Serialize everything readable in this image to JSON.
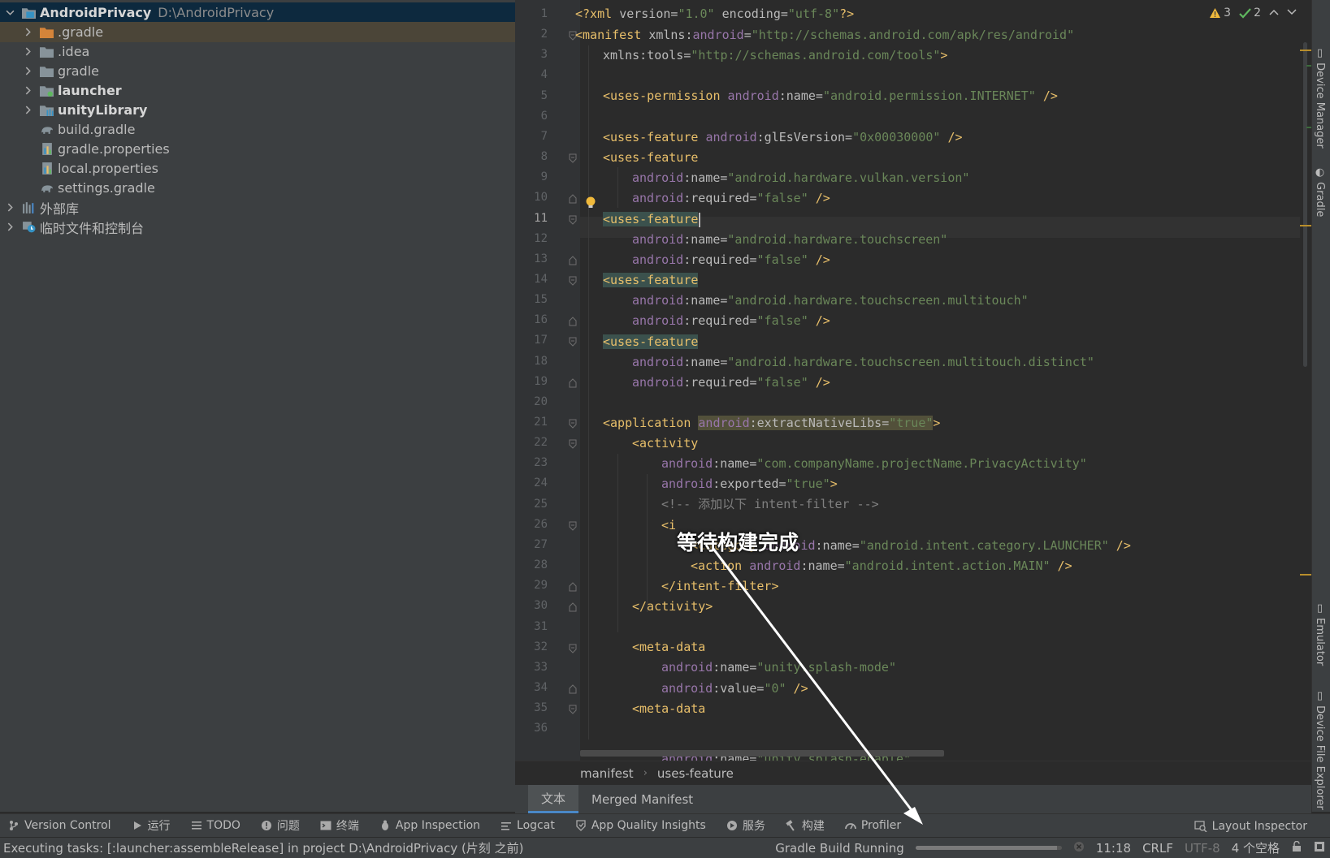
{
  "project_tree": {
    "root": {
      "name": "AndroidPrivacy",
      "path": "D:\\AndroidPrivacy"
    },
    "items": [
      {
        "label": ".gradle",
        "icon": "folder-orange-icon",
        "expandable": true,
        "bold": false
      },
      {
        "label": ".idea",
        "icon": "folder-icon",
        "expandable": true,
        "bold": false
      },
      {
        "label": "gradle",
        "icon": "folder-icon",
        "expandable": true,
        "bold": false
      },
      {
        "label": "launcher",
        "icon": "module-folder-icon",
        "expandable": true,
        "bold": true
      },
      {
        "label": "unityLibrary",
        "icon": "library-folder-icon",
        "expandable": true,
        "bold": true
      },
      {
        "label": "build.gradle",
        "icon": "gradle-elephant-icon",
        "expandable": false,
        "bold": false
      },
      {
        "label": "gradle.properties",
        "icon": "properties-file-icon",
        "expandable": false,
        "bold": false
      },
      {
        "label": "local.properties",
        "icon": "properties-file-icon",
        "expandable": false,
        "bold": false
      },
      {
        "label": "settings.gradle",
        "icon": "gradle-elephant-icon",
        "expandable": false,
        "bold": false
      }
    ],
    "external_libraries": "外部库",
    "scratches": "临时文件和控制台"
  },
  "editor": {
    "current_line": 11,
    "lines": [
      {
        "n": "1"
      },
      {
        "n": "2"
      },
      {
        "n": "3"
      },
      {
        "n": "4"
      },
      {
        "n": "5"
      },
      {
        "n": "6"
      },
      {
        "n": "7"
      },
      {
        "n": "8"
      },
      {
        "n": "9"
      },
      {
        "n": "10"
      },
      {
        "n": "11"
      },
      {
        "n": "12"
      },
      {
        "n": "13"
      },
      {
        "n": "14"
      },
      {
        "n": "15"
      },
      {
        "n": "16"
      },
      {
        "n": "17"
      },
      {
        "n": "18"
      },
      {
        "n": "19"
      },
      {
        "n": "20"
      },
      {
        "n": "21"
      },
      {
        "n": "22"
      },
      {
        "n": "23"
      },
      {
        "n": "24"
      },
      {
        "n": "25"
      },
      {
        "n": "26"
      },
      {
        "n": "27"
      },
      {
        "n": "28"
      },
      {
        "n": "29"
      },
      {
        "n": "30"
      },
      {
        "n": "31"
      },
      {
        "n": "32"
      },
      {
        "n": "33"
      },
      {
        "n": "34"
      },
      {
        "n": "35"
      },
      {
        "n": "36"
      }
    ],
    "code": {
      "l1": {
        "pi_open": "<?xml ",
        "a1": "version",
        "v1": "\"1.0\"",
        "a2": " encoding",
        "v2": "\"utf-8\"",
        "pi_close": "?>"
      },
      "l2": {
        "open": "<manifest ",
        "ns": "xmlns",
        "colon": ":",
        "attr": "android",
        "eq": "=",
        "val": "\"http://schemas.android.com/apk/res/android\""
      },
      "l3": {
        "ns": "xmlns",
        "colon": ":",
        "attr": "tools",
        "eq": "=",
        "val": "\"http://schemas.android.com/tools\"",
        "close": ">"
      },
      "l5": {
        "tag": "<uses-permission ",
        "ns": "android",
        "attr": ":name",
        "eq": "=",
        "val": "\"android.permission.INTERNET\"",
        "close": " />"
      },
      "l7": {
        "tag": "<uses-feature ",
        "ns": "android",
        "attr": ":glEsVersion",
        "eq": "=",
        "val": "\"0x00030000\"",
        "close": " />"
      },
      "l8": {
        "tag": "<uses-feature"
      },
      "l9": {
        "ns": "android",
        "attr": ":name",
        "eq": "=",
        "val": "\"android.hardware.vulkan.version\""
      },
      "l10": {
        "ns": "android",
        "attr": ":required",
        "eq": "=",
        "val": "\"false\"",
        "close": " />"
      },
      "l11": {
        "tag_lt": "<",
        "tag": "uses-feature"
      },
      "l12": {
        "ns": "android",
        "attr": ":name",
        "eq": "=",
        "val": "\"android.hardware.touchscreen\""
      },
      "l13": {
        "ns": "android",
        "attr": ":required",
        "eq": "=",
        "val": "\"false\"",
        "close": " />"
      },
      "l14": {
        "tag": "<uses-feature"
      },
      "l15": {
        "ns": "android",
        "attr": ":name",
        "eq": "=",
        "val": "\"android.hardware.touchscreen.multitouch\""
      },
      "l16": {
        "ns": "android",
        "attr": ":required",
        "eq": "=",
        "val": "\"false\"",
        "close": " />"
      },
      "l17": {
        "tag": "<uses-feature"
      },
      "l18": {
        "ns": "android",
        "attr": ":name",
        "eq": "=",
        "val": "\"android.hardware.touchscreen.multitouch.distinct\""
      },
      "l19": {
        "ns": "android",
        "attr": ":required",
        "eq": "=",
        "val": "\"false\"",
        "close": " />"
      },
      "l21": {
        "tag": "<application ",
        "ns": "android",
        "attr": ":extractNativeLibs",
        "eq": "=",
        "val": "\"true\"",
        "close": ">"
      },
      "l22": {
        "tag": "<activity"
      },
      "l23": {
        "ns": "android",
        "attr": ":name",
        "eq": "=",
        "val": "\"com.companyName.projectName.PrivacyActivity\""
      },
      "l24": {
        "ns": "android",
        "attr": ":exported",
        "eq": "=",
        "val": "\"true\"",
        "close": ">"
      },
      "l25": {
        "comment": "<!-- 添加以下 intent-filter -->"
      },
      "l26": {
        "tag": "<i"
      },
      "l27": {
        "tag": "<category ",
        "ns": "android",
        "attr": ":name",
        "eq": "=",
        "val": "\"android.intent.category.LAUNCHER\"",
        "close": " />"
      },
      "l28": {
        "tag": "<action ",
        "ns": "android",
        "attr": ":name",
        "eq": "=",
        "val": "\"android.intent.action.MAIN\"",
        "close": " />"
      },
      "l29": {
        "tag": "</intent-filter>"
      },
      "l30": {
        "tag": "</activity>"
      },
      "l32": {
        "tag": "<meta-data"
      },
      "l33": {
        "ns": "android",
        "attr": ":name",
        "eq": "=",
        "val": "\"unity.splash-mode\""
      },
      "l34": {
        "ns": "android",
        "attr": ":value",
        "eq": "=",
        "val": "\"0\"",
        "close": " />"
      },
      "l35": {
        "tag": "<meta-data"
      },
      "l36": {
        "ns": "android",
        "attr": ":name",
        "eq": "=",
        "val": "\"unity.splash-enable\""
      }
    },
    "inspections": {
      "warnings": "3",
      "typos": "2"
    }
  },
  "breadcrumb": [
    "manifest",
    "uses-feature"
  ],
  "editor_tabs": [
    {
      "label": "文本",
      "active": true
    },
    {
      "label": "Merged Manifest",
      "active": false
    }
  ],
  "right_tool_tabs": [
    "Device Manager",
    "Gradle",
    "Emulator",
    "Device File Explorer"
  ],
  "tool_windows": [
    {
      "label": "Version Control",
      "icon": "vcs-branch-icon"
    },
    {
      "label": "运行",
      "icon": "run-icon"
    },
    {
      "label": "TODO",
      "icon": "todo-list-icon"
    },
    {
      "label": "问题",
      "icon": "problems-icon"
    },
    {
      "label": "终端",
      "icon": "terminal-icon"
    },
    {
      "label": "App Inspection",
      "icon": "app-inspection-icon"
    },
    {
      "label": "Logcat",
      "icon": "logcat-icon"
    },
    {
      "label": "App Quality Insights",
      "icon": "quality-insights-icon"
    },
    {
      "label": "服务",
      "icon": "services-icon"
    },
    {
      "label": "构建",
      "icon": "build-hammer-icon"
    },
    {
      "label": "Profiler",
      "icon": "profiler-icon"
    }
  ],
  "layout_inspector": "Layout Inspector",
  "status": {
    "message": "Executing tasks: [:launcher:assembleRelease] in project D:\\AndroidPrivacy (片刻 之前)",
    "build_label": "Gradle Build Running",
    "progress": 0.97,
    "position": "11:18",
    "line_separator": "CRLF",
    "encoding": "UTF-8",
    "indent": "4 个空格"
  },
  "annotation": {
    "text": "等待构建完成"
  },
  "colors": {
    "accent": "#4a88c7",
    "tag": "#e8bf6a",
    "value": "#6a8759",
    "namespace": "#9876aa",
    "selection": "#0d293e"
  }
}
